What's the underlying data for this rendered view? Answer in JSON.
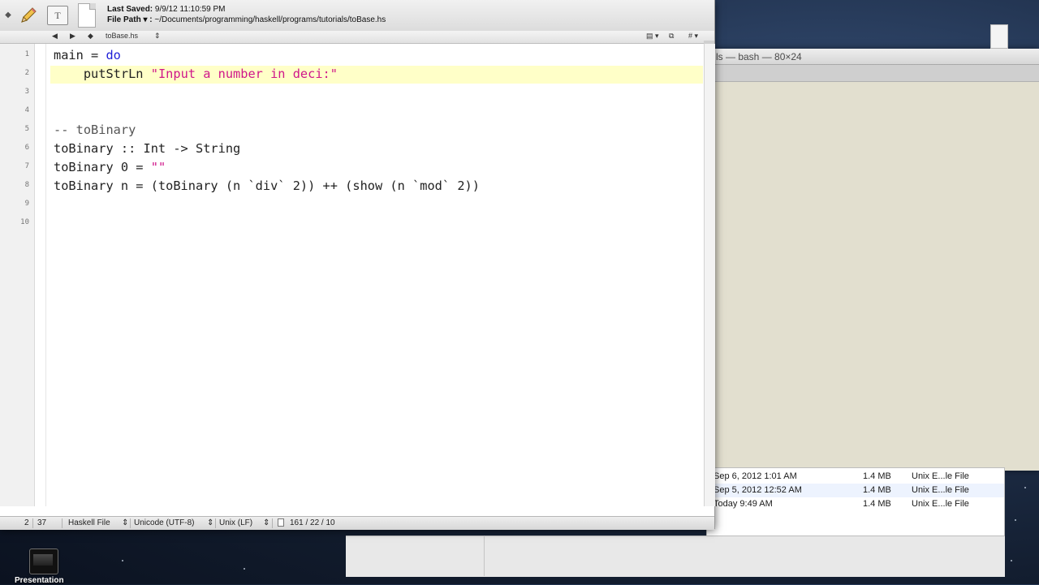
{
  "editor": {
    "last_saved_label": "Last Saved:",
    "last_saved_value": "9/9/12 11:10:59 PM",
    "file_path_label": "File Path ▾ :",
    "file_path_value": "~/Documents/programming/haskell/programs/tutorials/toBase.hs",
    "nav": {
      "prev": "◀",
      "next": "▶",
      "updown": "◆",
      "file_name": "toBase.hs",
      "file_arrows": "⇕",
      "right_1": "▤ ▾",
      "right_2": "⧉",
      "right_3": "# ▾"
    },
    "line_numbers": [
      "1",
      "2",
      "3",
      "4",
      "5",
      "6",
      "7",
      "8",
      "9",
      "10"
    ],
    "code": {
      "l1_a": "main = ",
      "l1_kw": "do",
      "l2_a": "    putStrLn ",
      "l2_str": "\"Input a number in deci:\"",
      "l5_cmt": "-- toBinary",
      "l6": "toBinary :: Int -> String",
      "l7_a": "toBinary 0 = ",
      "l7_str": "\"\"",
      "l8": "toBinary n = (toBinary (n `div` 2)) ++ (show (n `mod` 2))"
    },
    "status": {
      "line": "2",
      "col": "37",
      "syntax": "Haskell File",
      "encoding": "Unicode (UTF-8)",
      "line_endings": "Unix (LF)",
      "counts": "161 / 22 / 10",
      "arrows": "⇕"
    },
    "highlight_color": "#ffffc8"
  },
  "terminal": {
    "title": "ls — bash — 80×24"
  },
  "finder": {
    "rows": [
      {
        "date": "Sep 6, 2012 1:01 AM",
        "size": "1.4 MB",
        "kind": "Unix E...le File"
      },
      {
        "date": "Sep 5, 2012 12:52 AM",
        "size": "1.4 MB",
        "kind": "Unix E...le File"
      },
      {
        "date": "Today 9:49 AM",
        "size": "1.4 MB",
        "kind": "Unix E...le File"
      }
    ]
  },
  "dock": {
    "label": "Presentation"
  }
}
